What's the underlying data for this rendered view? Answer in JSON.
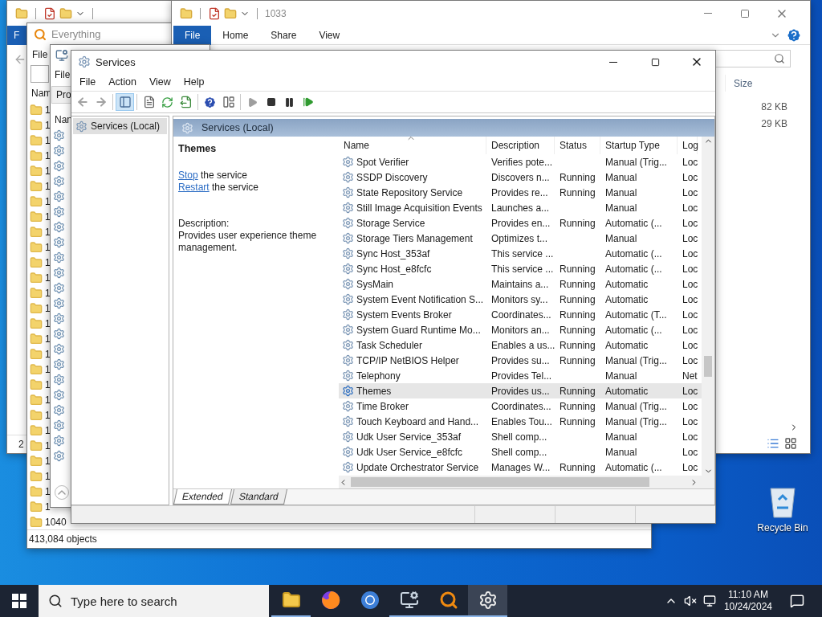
{
  "explorer_back": {
    "ribbon_tabs": [
      {
        "label": "F",
        "selected": true
      }
    ],
    "status": "2"
  },
  "everything": {
    "title": "Everything",
    "menu": [
      "File"
    ],
    "column": "Nam",
    "rows": [
      "1",
      "1",
      "1",
      "1",
      "1",
      "1",
      "1",
      "1",
      "1",
      "1",
      "1",
      "1",
      "1",
      "1",
      "1",
      "1",
      "1",
      "1",
      "1",
      "1",
      "1",
      "1",
      "1",
      "1",
      "1",
      "1",
      "1",
      "1040"
    ],
    "status": "413,084 objects"
  },
  "explorer_1033": {
    "title": "1033",
    "ribbon_tabs": [
      {
        "label": "File",
        "selected": true
      },
      {
        "label": "Home",
        "selected": false
      },
      {
        "label": "Share",
        "selected": false
      },
      {
        "label": "View",
        "selected": false
      }
    ],
    "columns": [
      "Size"
    ],
    "rows": [
      {
        "size": "82 KB"
      },
      {
        "size": "29 KB"
      }
    ]
  },
  "services_back": {
    "menu": [
      "File"
    ],
    "tab": "Pro",
    "column": "Nan"
  },
  "services": {
    "title": "Services",
    "menu": [
      "File",
      "Action",
      "View",
      "Help"
    ],
    "toolbar": [
      {
        "kind": "back",
        "disabled": true,
        "selected": false
      },
      {
        "kind": "forward",
        "disabled": true,
        "selected": false
      },
      {
        "kind": "separator"
      },
      {
        "kind": "tree",
        "disabled": false,
        "selected": true
      },
      {
        "kind": "separator"
      },
      {
        "kind": "properties",
        "disabled": false,
        "selected": false
      },
      {
        "kind": "refresh",
        "disabled": false,
        "selected": false
      },
      {
        "kind": "export",
        "disabled": false,
        "selected": false
      },
      {
        "kind": "separator"
      },
      {
        "kind": "help",
        "disabled": false,
        "selected": false
      },
      {
        "kind": "console",
        "disabled": false,
        "selected": false
      },
      {
        "kind": "separator"
      },
      {
        "kind": "start",
        "disabled": true,
        "selected": false
      },
      {
        "kind": "stop",
        "disabled": false,
        "selected": false
      },
      {
        "kind": "pause",
        "disabled": false,
        "selected": false
      },
      {
        "kind": "restart",
        "disabled": false,
        "selected": false
      }
    ],
    "tree": [
      {
        "label": "Services (Local)",
        "selected": true
      }
    ],
    "header": "Services (Local)",
    "detail": {
      "name": "Themes",
      "actions": [
        {
          "link": "Stop",
          "text": "the service"
        },
        {
          "link": "Restart",
          "text": "the service"
        }
      ],
      "description_label": "Description:",
      "description": "Provides user experience theme management."
    },
    "columns": [
      "Name",
      "Description",
      "Status",
      "Startup Type",
      "Log"
    ],
    "rows": [
      {
        "name": "Spot Verifier",
        "description": "Verifies pote...",
        "status": "",
        "startup": "Manual (Trig...",
        "logon": "Loc",
        "selected": false
      },
      {
        "name": "SSDP Discovery",
        "description": "Discovers n...",
        "status": "Running",
        "startup": "Manual",
        "logon": "Loc",
        "selected": false
      },
      {
        "name": "State Repository Service",
        "description": "Provides re...",
        "status": "Running",
        "startup": "Manual",
        "logon": "Loc",
        "selected": false
      },
      {
        "name": "Still Image Acquisition Events",
        "description": "Launches a...",
        "status": "",
        "startup": "Manual",
        "logon": "Loc",
        "selected": false
      },
      {
        "name": "Storage Service",
        "description": "Provides en...",
        "status": "Running",
        "startup": "Automatic (...",
        "logon": "Loc",
        "selected": false
      },
      {
        "name": "Storage Tiers Management",
        "description": "Optimizes t...",
        "status": "",
        "startup": "Manual",
        "logon": "Loc",
        "selected": false
      },
      {
        "name": "Sync Host_353af",
        "description": "This service ...",
        "status": "",
        "startup": "Automatic (...",
        "logon": "Loc",
        "selected": false
      },
      {
        "name": "Sync Host_e8fcfc",
        "description": "This service ...",
        "status": "Running",
        "startup": "Automatic (...",
        "logon": "Loc",
        "selected": false
      },
      {
        "name": "SysMain",
        "description": "Maintains a...",
        "status": "Running",
        "startup": "Automatic",
        "logon": "Loc",
        "selected": false
      },
      {
        "name": "System Event Notification S...",
        "description": "Monitors sy...",
        "status": "Running",
        "startup": "Automatic",
        "logon": "Loc",
        "selected": false
      },
      {
        "name": "System Events Broker",
        "description": "Coordinates...",
        "status": "Running",
        "startup": "Automatic (T...",
        "logon": "Loc",
        "selected": false
      },
      {
        "name": "System Guard Runtime Mo...",
        "description": "Monitors an...",
        "status": "Running",
        "startup": "Automatic (...",
        "logon": "Loc",
        "selected": false
      },
      {
        "name": "Task Scheduler",
        "description": "Enables a us...",
        "status": "Running",
        "startup": "Automatic",
        "logon": "Loc",
        "selected": false
      },
      {
        "name": "TCP/IP NetBIOS Helper",
        "description": "Provides su...",
        "status": "Running",
        "startup": "Manual (Trig...",
        "logon": "Loc",
        "selected": false
      },
      {
        "name": "Telephony",
        "description": "Provides Tel...",
        "status": "",
        "startup": "Manual",
        "logon": "Net",
        "selected": false
      },
      {
        "name": "Themes",
        "description": "Provides us...",
        "status": "Running",
        "startup": "Automatic",
        "logon": "Loc",
        "selected": true
      },
      {
        "name": "Time Broker",
        "description": "Coordinates...",
        "status": "Running",
        "startup": "Manual (Trig...",
        "logon": "Loc",
        "selected": false
      },
      {
        "name": "Touch Keyboard and Hand...",
        "description": "Enables Tou...",
        "status": "Running",
        "startup": "Manual (Trig...",
        "logon": "Loc",
        "selected": false
      },
      {
        "name": "Udk User Service_353af",
        "description": "Shell comp...",
        "status": "",
        "startup": "Manual",
        "logon": "Loc",
        "selected": false
      },
      {
        "name": "Udk User Service_e8fcfc",
        "description": "Shell comp...",
        "status": "",
        "startup": "Manual",
        "logon": "Loc",
        "selected": false
      },
      {
        "name": "Update Orchestrator Service",
        "description": "Manages W...",
        "status": "Running",
        "startup": "Automatic (...",
        "logon": "Loc",
        "selected": false
      }
    ],
    "tabs": [
      {
        "label": "Extended",
        "selected": true
      },
      {
        "label": "Standard",
        "selected": false
      }
    ]
  },
  "desktop_icons": [
    {
      "label": "Recycle Bin"
    }
  ],
  "taskbar": {
    "search": {
      "placeholder": "Type here to search"
    },
    "apps": [
      {
        "kind": "folder",
        "open": true,
        "active": false
      },
      {
        "kind": "firefox",
        "open": false,
        "active": false
      },
      {
        "kind": "chrome",
        "open": false,
        "active": false
      },
      {
        "kind": "console",
        "open": true,
        "active": false
      },
      {
        "kind": "everything",
        "open": true,
        "active": false
      },
      {
        "kind": "services",
        "open": true,
        "active": true
      }
    ],
    "time": "11:10 AM",
    "date": "10/24/2024"
  }
}
